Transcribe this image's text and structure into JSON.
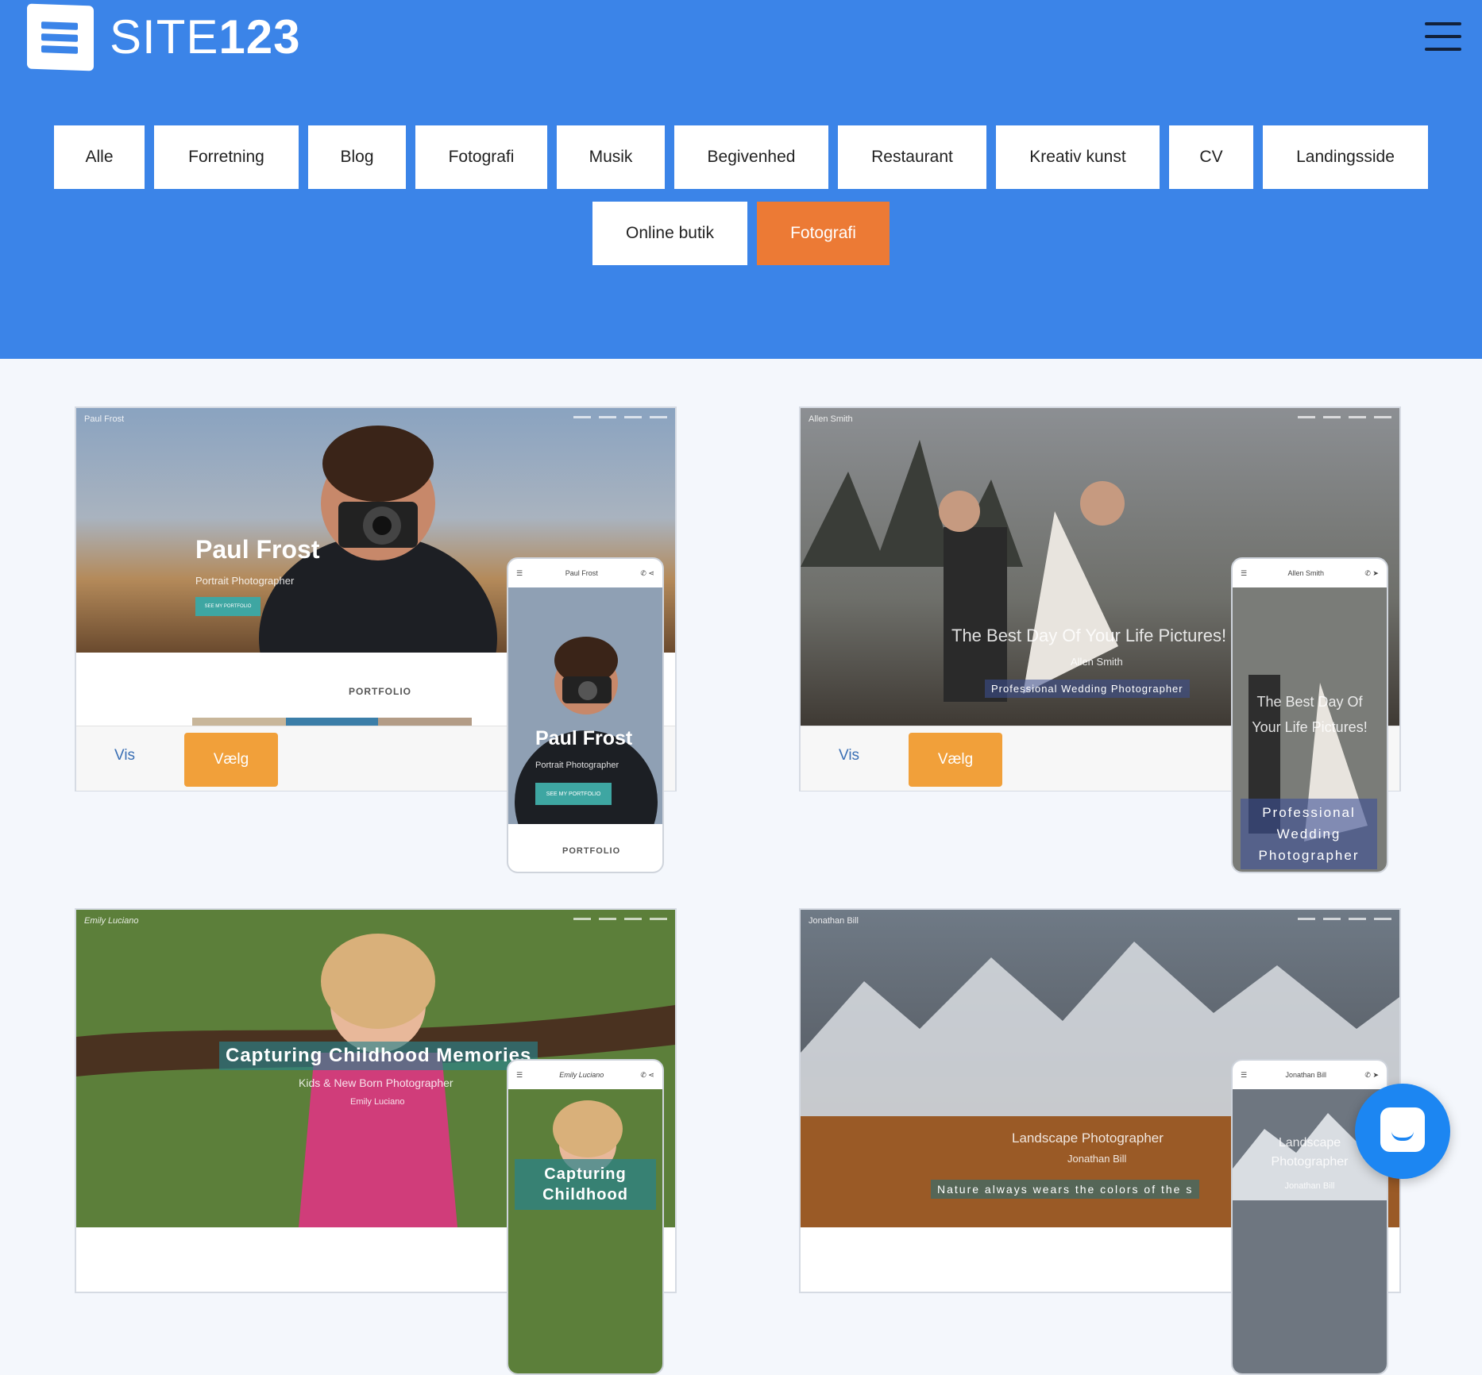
{
  "brand": {
    "site": "SITE",
    "num": "123"
  },
  "filters": {
    "row1": [
      "Alle",
      "Forretning",
      "Blog",
      "Fotografi",
      "Musik",
      "Begivenhed",
      "Restaurant",
      "Kreativ kunst",
      "CV",
      "Landingsside"
    ],
    "row2": [
      "Online butik",
      "Fotografi"
    ]
  },
  "cards": [
    {
      "site_name": "Paul Frost",
      "title": "Paul Frost",
      "subtitle": "Portrait Photographer",
      "cta": "SEE MY PORTFOLIO",
      "section": "PORTFOLIO",
      "vis": "Vis",
      "vaelg": "Vælg"
    },
    {
      "site_name": "Allen Smith",
      "title": "The Best Day Of Your Life Pictures!",
      "subtitle": "Allen Smith",
      "tagline": "Professional Wedding Photographer",
      "mobile_title": "The Best Day Of Your Life Pictures!",
      "mobile_tag": "Professional Wedding Photographer",
      "vis": "Vis",
      "vaelg": "Vælg"
    },
    {
      "site_name": "Emily Luciano",
      "title": "Capturing Childhood Memories",
      "subtitle": "Kids & New Born Photographer",
      "name": "Emily Luciano",
      "mobile_title": "Capturing Childhood"
    },
    {
      "site_name": "Jonathan Bill",
      "title": "Landscape Photographer",
      "subtitle": "Jonathan Bill",
      "tagline": "Nature always wears the colors of the s",
      "mobile_title": "Landscape Photographer",
      "mobile_name": "Jonathan Bill"
    }
  ],
  "colors": {
    "header": "#3b84e8",
    "active": "#ec7a35",
    "choose": "#f1a03a"
  }
}
